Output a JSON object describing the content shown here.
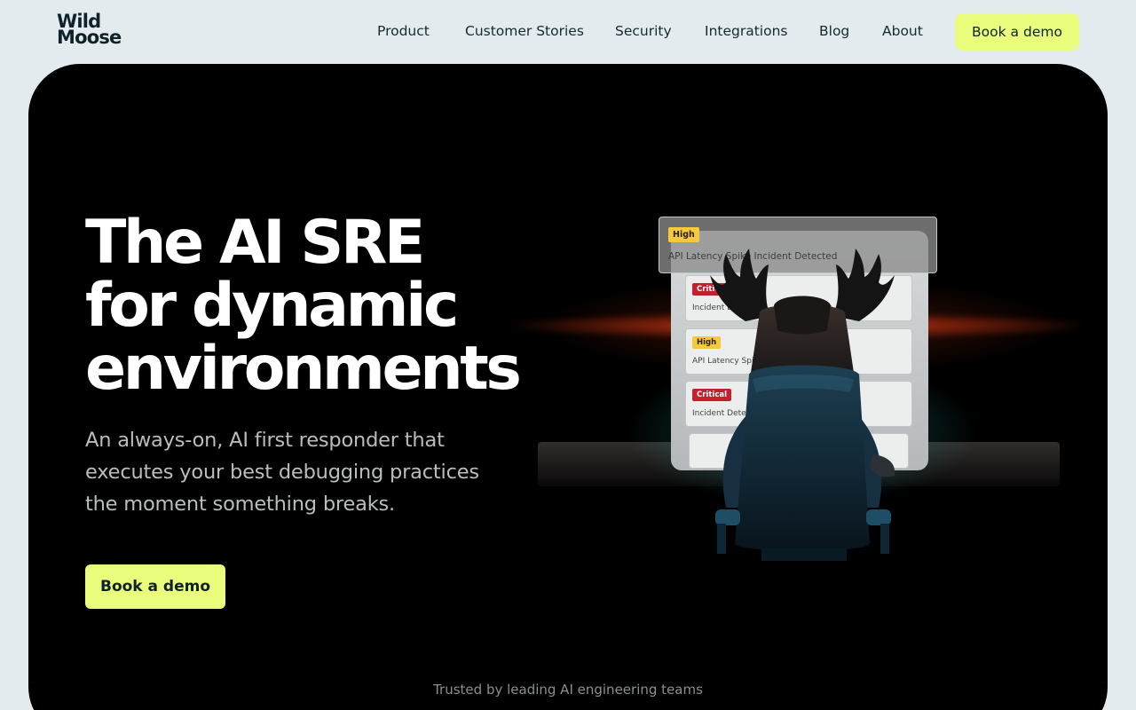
{
  "brand": {
    "line1": "Wild",
    "line2": "Moose"
  },
  "nav": {
    "items": [
      "Product",
      "Customer Stories",
      "Security",
      "Integrations",
      "Blog",
      "About"
    ],
    "cta": "Book a demo"
  },
  "hero": {
    "headline": [
      "The AI SRE",
      "for dynamic",
      "environments"
    ],
    "subtitle": [
      "An always-on, AI first responder that",
      "executes your best debugging practices",
      "the moment something breaks."
    ],
    "cta": "Book a demo",
    "trusted": "Trusted by leading AI engineering teams"
  },
  "illustration": {
    "cards": [
      {
        "severity": "High",
        "title": "API Latency Spike Incident Detected"
      },
      {
        "severity": "Critical",
        "title": "Incident Detected — Latency Spike"
      },
      {
        "severity": "High",
        "title": "API Latency Spike"
      },
      {
        "severity": "Critical",
        "title": "Incident Detected"
      }
    ]
  },
  "colors": {
    "accent": "#eafc7b",
    "hero_bg": "#000000",
    "page_bg": "#e3ebee",
    "critical": "#c31f2c",
    "high": "#f5c93a"
  }
}
